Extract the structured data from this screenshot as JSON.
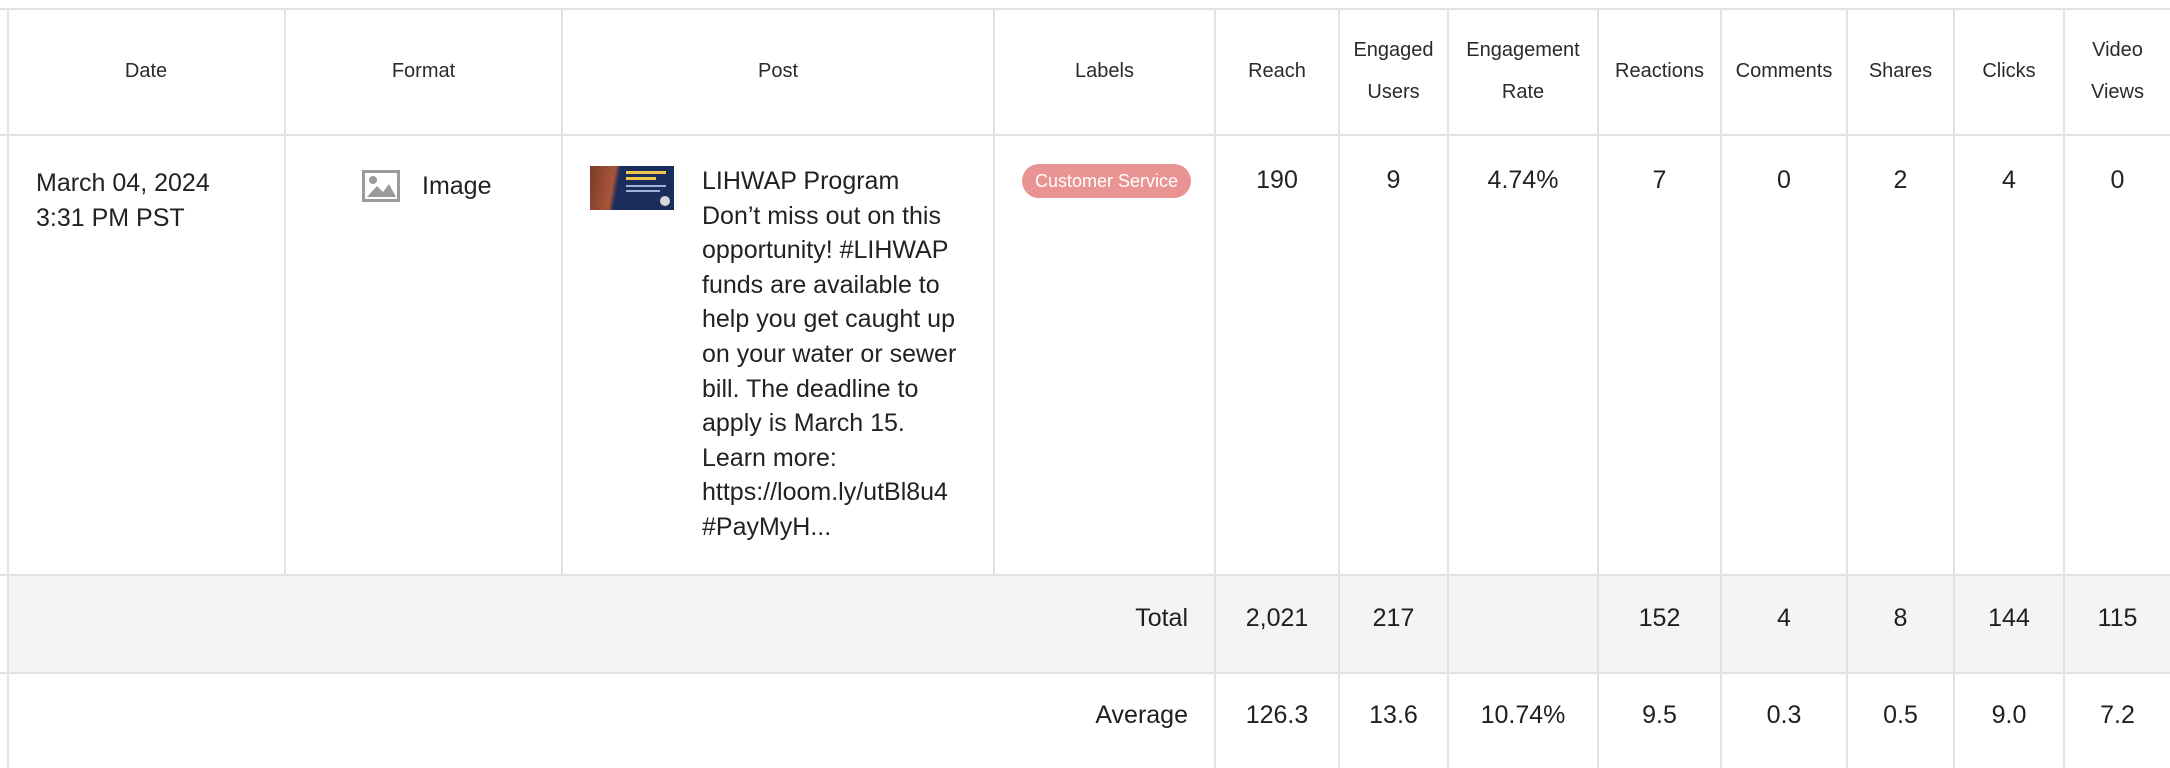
{
  "headers": {
    "date": "Date",
    "format": "Format",
    "post": "Post",
    "labels": "Labels",
    "reach": "Reach",
    "engaged_users": [
      "Engaged",
      "Users"
    ],
    "engagement_rate": [
      "Engagement",
      "Rate"
    ],
    "reactions": "Reactions",
    "comments": "Comments",
    "shares": "Shares",
    "clicks": "Clicks",
    "video_views": [
      "Video",
      "Views"
    ]
  },
  "row": {
    "date_line1": "March 04, 2024",
    "date_line2": "3:31 PM PST",
    "format_icon": "image-icon",
    "format": "Image",
    "post_title": "LIHWAP Program",
    "post_lines": [
      "Don’t miss out on this",
      "opportunity! #LIHWAP",
      "funds are available to",
      "help you get caught up",
      "on your water or sewer",
      "bill. The deadline to",
      "apply is March 15.",
      "Learn more:",
      "https://loom.ly/utBl8u4",
      "#PayMyH..."
    ],
    "label": "Customer Service",
    "label_color": "#e99393",
    "reach": "190",
    "engaged_users": "9",
    "engagement_rate": "4.74%",
    "reactions": "7",
    "comments": "0",
    "shares": "2",
    "clicks": "4",
    "video_views": "0"
  },
  "total": {
    "label": "Total",
    "reach": "2,021",
    "engaged_users": "217",
    "engagement_rate": "",
    "reactions": "152",
    "comments": "4",
    "shares": "8",
    "clicks": "144",
    "video_views": "115"
  },
  "average": {
    "label": "Average",
    "reach": "126.3",
    "engaged_users": "13.6",
    "engagement_rate": "10.74%",
    "reactions": "9.5",
    "comments": "0.3",
    "shares": "0.5",
    "clicks": "9.0",
    "video_views": "7.2"
  }
}
